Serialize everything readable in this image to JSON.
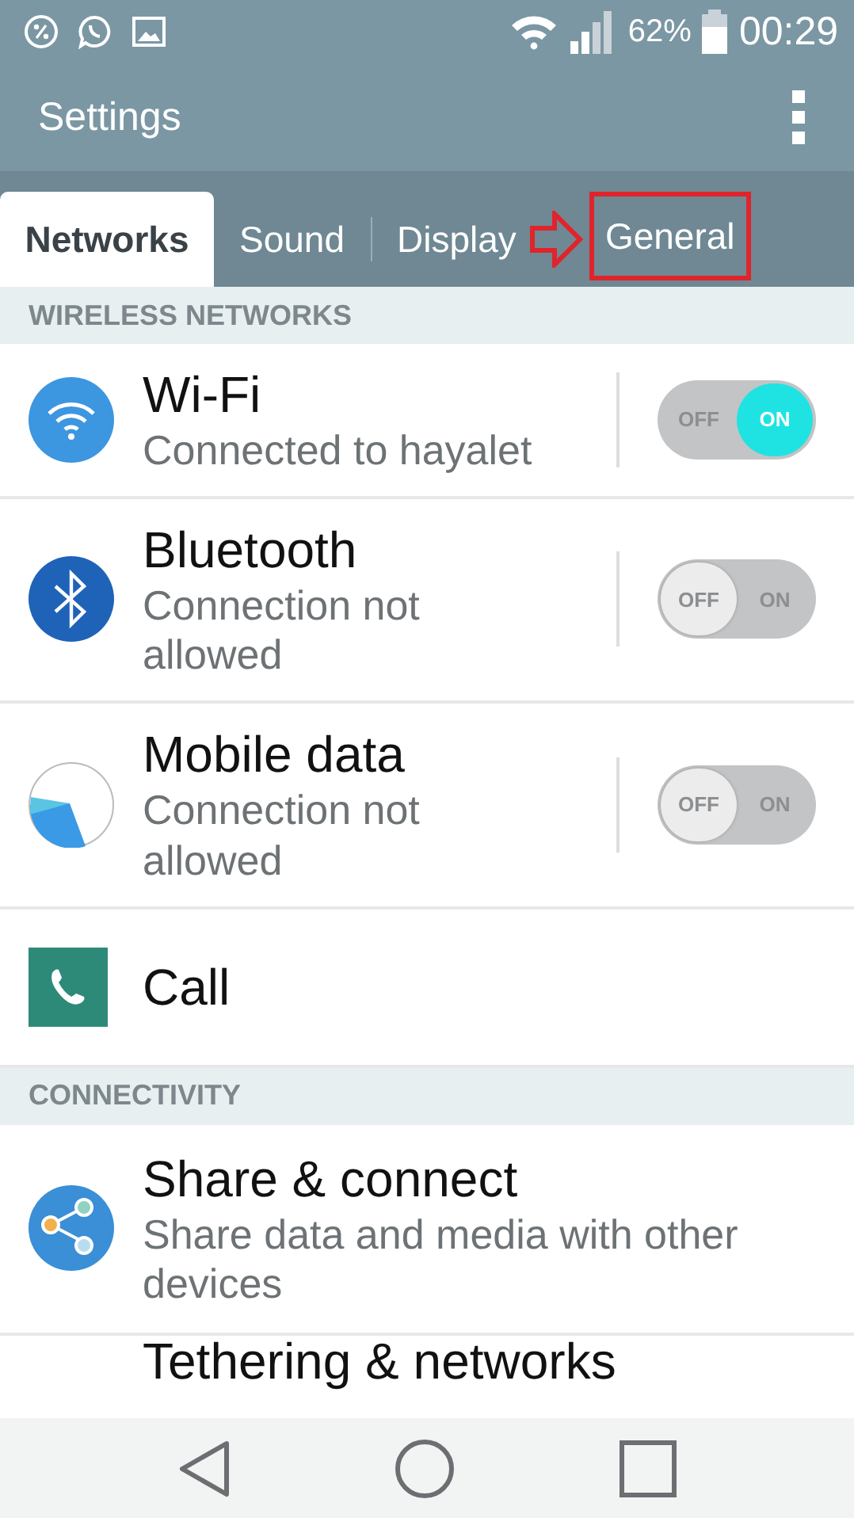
{
  "status_bar": {
    "battery": "62%",
    "time": "00:29"
  },
  "app_bar": {
    "title": "Settings"
  },
  "tabs": [
    {
      "label": "Networks",
      "selected": true,
      "highlighted": false
    },
    {
      "label": "Sound",
      "selected": false,
      "highlighted": false
    },
    {
      "label": "Display",
      "selected": false,
      "highlighted": false
    },
    {
      "label": "General",
      "selected": false,
      "highlighted": true
    }
  ],
  "sections": [
    {
      "header": "WIRELESS NETWORKS",
      "items": [
        {
          "kind": "toggle",
          "title": "Wi-Fi",
          "subtitle": "Connected to hayalet",
          "on": true,
          "off_label": "OFF",
          "on_label": "ON"
        },
        {
          "kind": "toggle",
          "title": "Bluetooth",
          "subtitle": "Connection not allowed",
          "on": false,
          "off_label": "OFF",
          "on_label": "ON"
        },
        {
          "kind": "toggle",
          "title": "Mobile data",
          "subtitle": "Connection not allowed",
          "on": false,
          "off_label": "OFF",
          "on_label": "ON"
        },
        {
          "kind": "link",
          "title": "Call"
        }
      ]
    },
    {
      "header": "CONNECTIVITY",
      "items": [
        {
          "kind": "link",
          "title": "Share & connect",
          "subtitle": "Share data and media with other devices"
        },
        {
          "kind": "partial",
          "title": "Tethering & networks"
        }
      ]
    }
  ]
}
